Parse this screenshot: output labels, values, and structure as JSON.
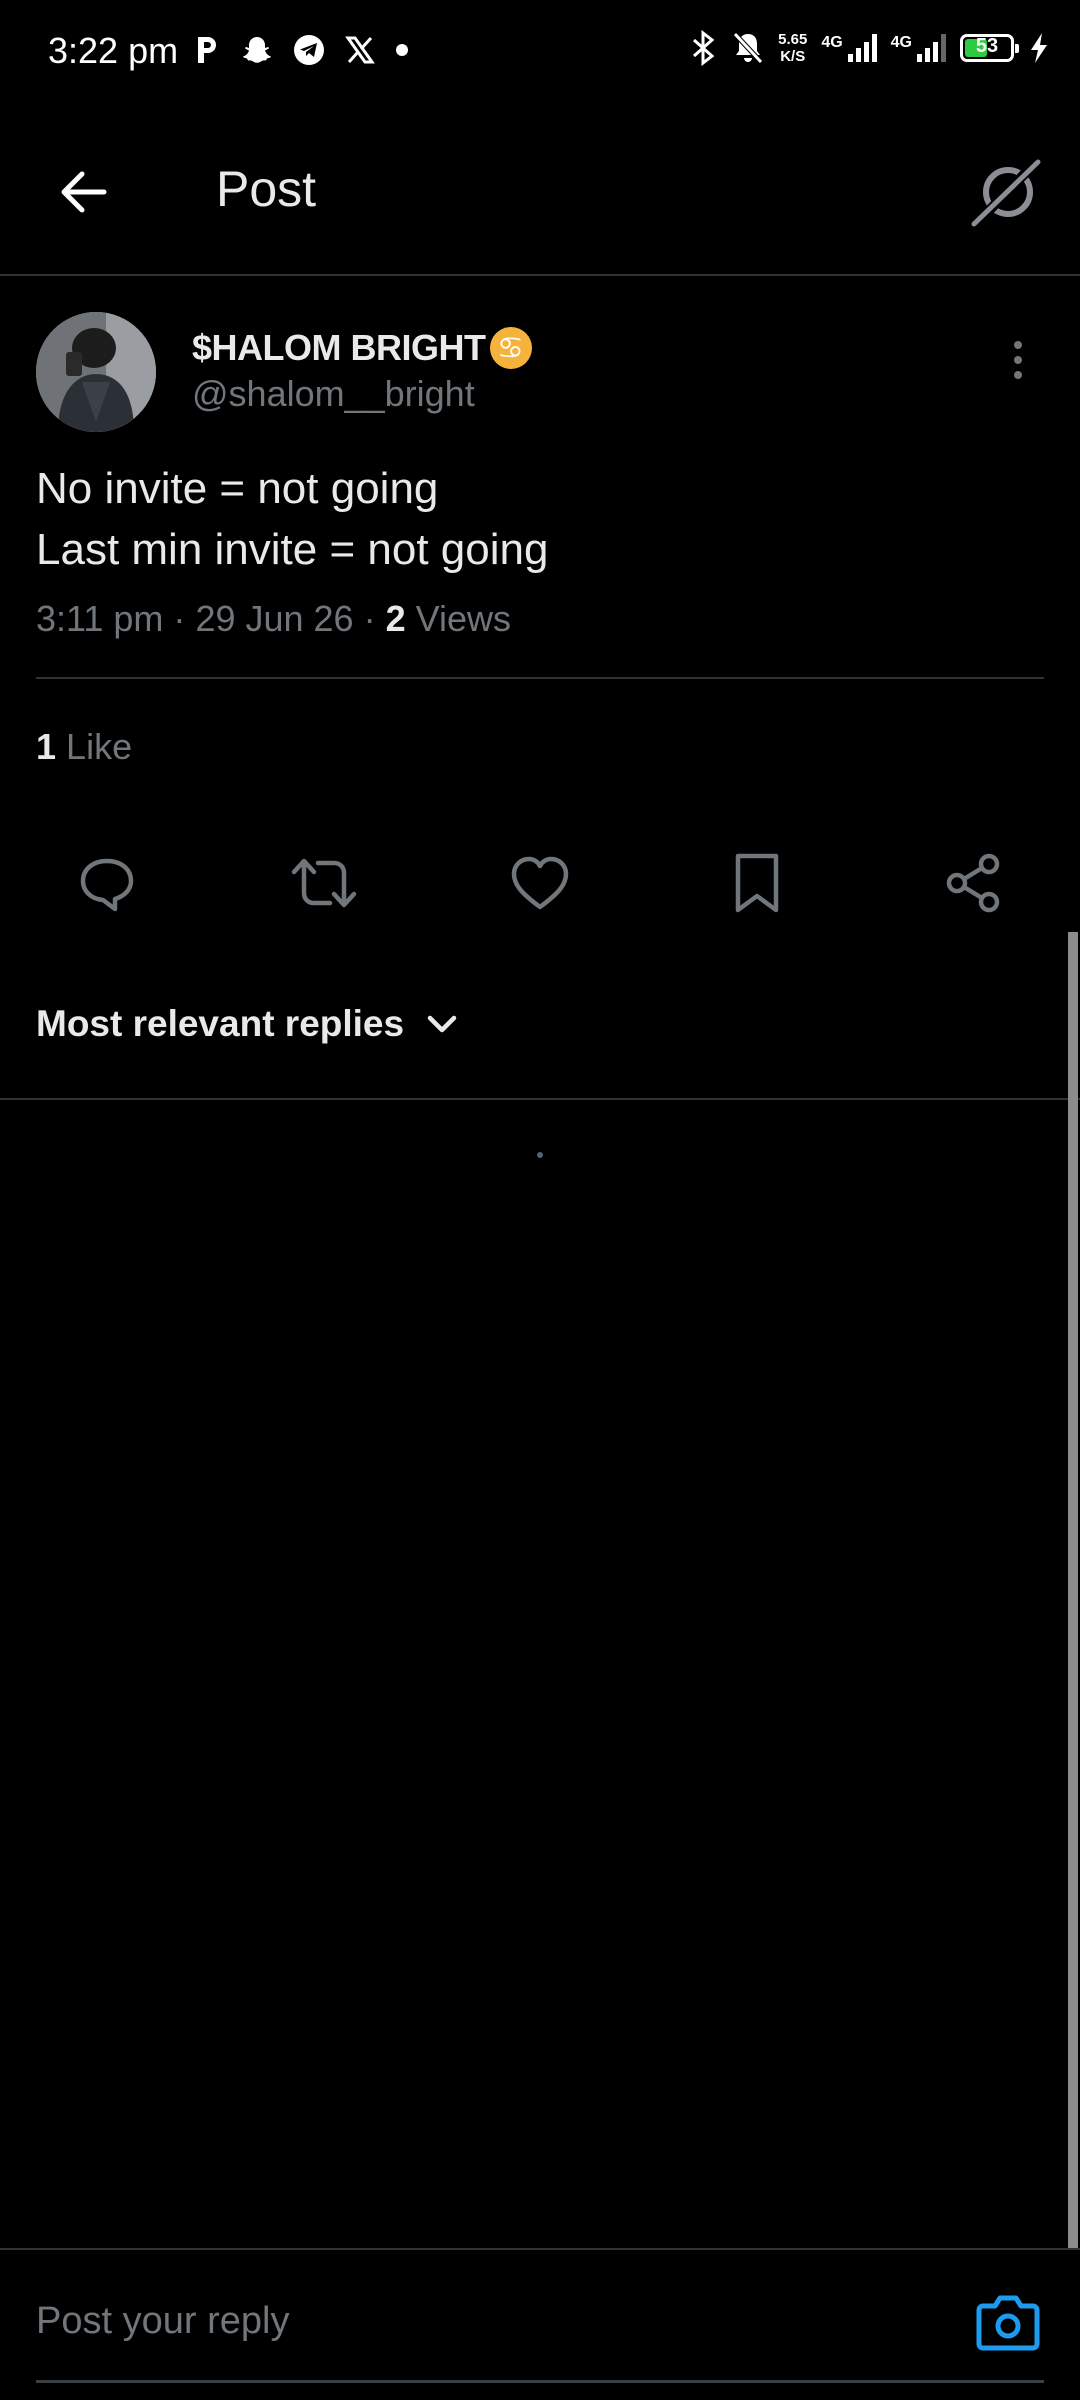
{
  "status_bar": {
    "time": "3:22 pm",
    "net_speed_value": "5.65",
    "net_speed_unit": "K/S",
    "sim1_label": "4G",
    "sim2_label": "4G",
    "battery_level": "53",
    "notification_icons": [
      "parking-app-icon",
      "snapchat-icon",
      "telegram-icon",
      "x-icon",
      "dot-icon"
    ],
    "system_icons": [
      "bluetooth-icon",
      "bell-muted-icon",
      "signal-icon",
      "signal-icon",
      "battery-icon",
      "charging-icon"
    ]
  },
  "header": {
    "title": "Post"
  },
  "post": {
    "author_name": "$HALOM BRIGHT",
    "author_emoji": "♋",
    "author_handle": "@shalom__bright",
    "text_line_1": "No invite = not going",
    "text_line_2": "Last min invite = not going",
    "time": "3:11 pm",
    "date": "29 Jun 26",
    "separator": "·",
    "views_count": "2",
    "views_label": "Views",
    "likes_count": "1",
    "likes_label": "Like"
  },
  "actions": [
    "reply-icon",
    "repost-icon",
    "like-icon",
    "bookmark-icon",
    "share-icon"
  ],
  "replies_sort": {
    "label": "Most relevant replies"
  },
  "reply_bar": {
    "placeholder": "Post your reply"
  },
  "colors": {
    "background": "#000000",
    "text_primary": "#e7e9ea",
    "text_secondary": "#71767b",
    "divider": "#2f3336",
    "accent": "#1d9bf0",
    "zodiac_badge": "#f5b33b",
    "battery_fill": "#2ecc40"
  }
}
